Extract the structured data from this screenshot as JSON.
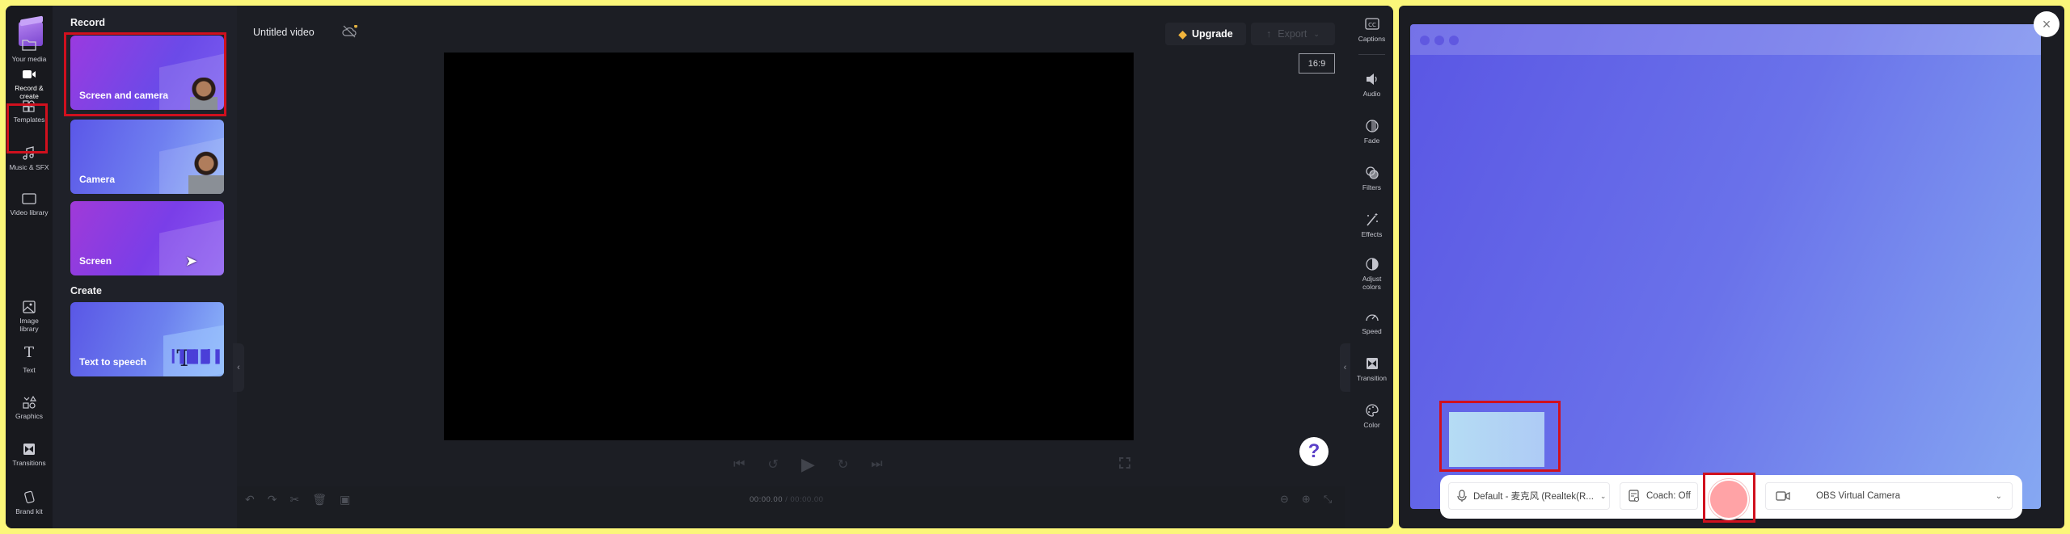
{
  "sidebar": {
    "items": [
      {
        "label": "Your media",
        "icon": "folder-icon"
      },
      {
        "label": "Record &\ncreate",
        "icon": "video-camera-icon",
        "active": true
      },
      {
        "label": "Templates",
        "icon": "templates-icon"
      },
      {
        "label": "Music & SFX",
        "icon": "music-note-icon"
      },
      {
        "label": "Video library",
        "icon": "film-icon"
      },
      {
        "label": "Image\nlibrary",
        "icon": "image-icon"
      },
      {
        "label": "Text",
        "icon": "text-icon"
      },
      {
        "label": "Graphics",
        "icon": "shapes-icon"
      },
      {
        "label": "Transitions",
        "icon": "transition-icon"
      },
      {
        "label": "Brand kit",
        "icon": "brand-kit-icon"
      }
    ]
  },
  "panel": {
    "record_title": "Record",
    "create_title": "Create",
    "record_cards": [
      "Screen and camera",
      "Camera",
      "Screen"
    ],
    "create_cards": [
      "Text to speech"
    ],
    "tts_glyph": "T",
    "tts_wave": "▎▌█▌█▎▌"
  },
  "header": {
    "title": "Untitled video",
    "upgrade_label": "Upgrade",
    "export_label": "Export"
  },
  "preview": {
    "aspect_ratio": "16:9",
    "time_current": "00:00.00",
    "time_total": "/ 00:00.00",
    "help_label": "?"
  },
  "right_rail": {
    "items": [
      {
        "label": "Captions",
        "icon": "captions-icon"
      },
      {
        "label": "Audio",
        "icon": "speaker-icon"
      },
      {
        "label": "Fade",
        "icon": "fade-icon"
      },
      {
        "label": "Filters",
        "icon": "filters-icon"
      },
      {
        "label": "Effects",
        "icon": "magic-wand-icon"
      },
      {
        "label": "Adjust\ncolors",
        "icon": "contrast-icon"
      },
      {
        "label": "Speed",
        "icon": "speedometer-icon"
      },
      {
        "label": "Transition",
        "icon": "transition-icon"
      },
      {
        "label": "Color",
        "icon": "palette-icon"
      }
    ]
  },
  "recorder": {
    "microphone": "Default - 麦克风 (Realtek(R...",
    "coach": "Coach: Off",
    "camera": "OBS Virtual Camera",
    "close_label": "×",
    "accent_record": "#ffa3a6"
  },
  "highlight_color": "#d0101e"
}
